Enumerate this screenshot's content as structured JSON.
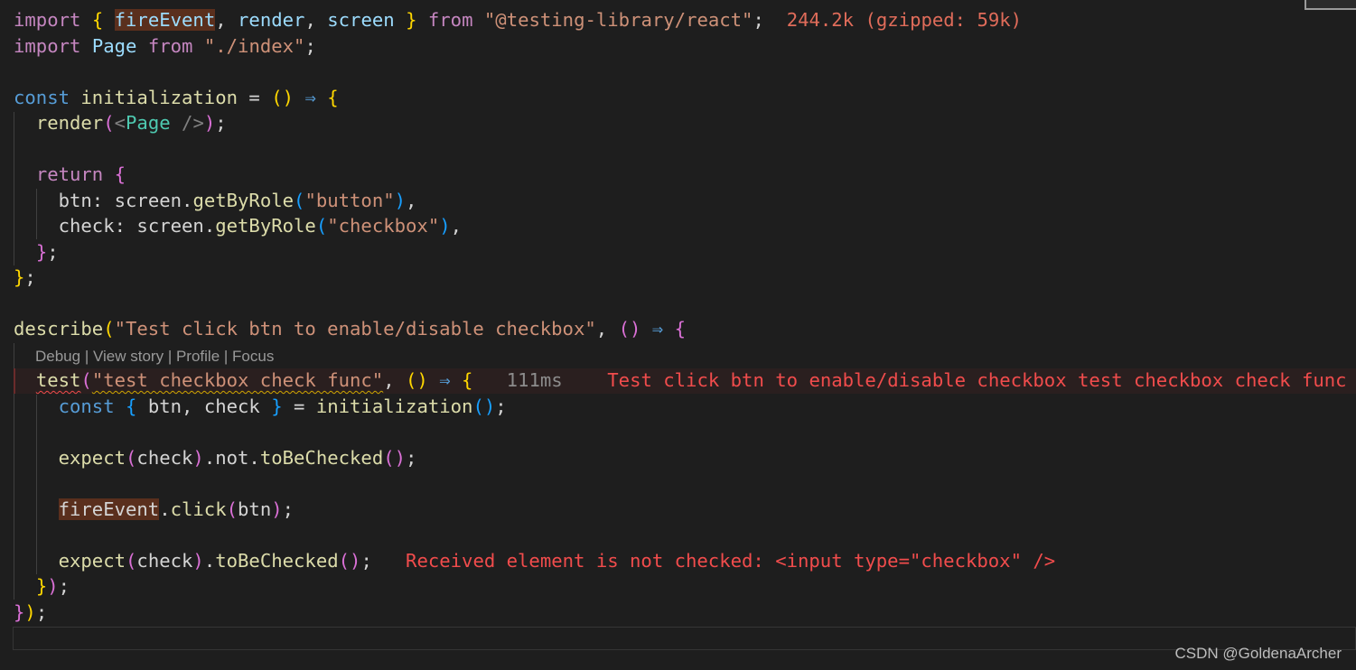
{
  "editor": {
    "lines": {
      "l1": {
        "import_kw": "import",
        "brace_open": "{",
        "fireEvent": "fireEvent",
        "comma1": ",",
        "render": "render",
        "comma2": ",",
        "screen": "screen",
        "brace_close": "}",
        "from_kw": "from",
        "module": "\"@testing-library/react\"",
        "semi": ";",
        "size_hint": "244.2k (gzipped: 59k)"
      },
      "l2": {
        "import_kw": "import",
        "page": "Page",
        "from_kw": "from",
        "module": "\"./index\"",
        "semi": ";"
      },
      "l4": {
        "const_kw": "const",
        "name": "initialization",
        "eq": "=",
        "parens": "()",
        "arrow": "⇒",
        "brace": "{"
      },
      "l5": {
        "render": "render",
        "paren_open": "(",
        "tag_open": "<",
        "tag_name": "Page",
        "tag_close": "/>",
        "paren_close": ")",
        "semi": ";"
      },
      "l7": {
        "return_kw": "return",
        "brace": "{"
      },
      "l8": {
        "prop": "btn:",
        "obj": "screen",
        "dot": ".",
        "method": "getByRole",
        "paren_open": "(",
        "arg": "\"button\"",
        "paren_close": ")",
        "comma": ","
      },
      "l9": {
        "prop": "check:",
        "obj": "screen",
        "dot": ".",
        "method": "getByRole",
        "paren_open": "(",
        "arg": "\"checkbox\"",
        "paren_close": ")",
        "comma": ","
      },
      "l10": {
        "brace": "}",
        "semi": ";"
      },
      "l11": {
        "brace": "}",
        "semi": ";"
      },
      "l13": {
        "fn": "describe",
        "paren_open": "(",
        "arg": "\"Test click btn to enable/disable checkbox\"",
        "comma": ",",
        "parens": "()",
        "arrow": "⇒",
        "brace": "{"
      },
      "l14": {
        "fn": "test",
        "paren_open": "(",
        "arg": "\"test checkbox check func\"",
        "comma": ",",
        "parens": "()",
        "arrow": "⇒",
        "brace": "{",
        "duration": "111ms",
        "error": "Test click btn to enable/disable checkbox test checkbox check func"
      },
      "l15": {
        "const_kw": "const",
        "brace_open": "{",
        "names": "btn, check",
        "brace_close": "}",
        "eq": "=",
        "fn": "initialization",
        "parens": "()",
        "semi": ";"
      },
      "l17": {
        "fn": "expect",
        "paren_open": "(",
        "arg": "check",
        "paren_close": ")",
        "chain": ".not.",
        "method": "toBeChecked",
        "parens": "()",
        "semi": ";"
      },
      "l19": {
        "obj": "fireEvent",
        "dot": ".",
        "method": "click",
        "paren_open": "(",
        "arg": "btn",
        "paren_close": ")",
        "semi": ";"
      },
      "l21": {
        "fn": "expect",
        "paren_open": "(",
        "arg": "check",
        "paren_close": ")",
        "dot": ".",
        "method": "toBeChecked",
        "parens": "()",
        "semi": ";",
        "error": "Received element is not checked: <input type=\"checkbox\" />"
      },
      "l22": {
        "brace": "}",
        "paren": ")",
        "semi": ";"
      },
      "l23": {
        "brace": "}",
        "paren": ")",
        "semi": ";"
      }
    },
    "codelens": {
      "debug": "Debug",
      "sep1": " | ",
      "view_story": "View story",
      "sep2": " | ",
      "profile": "Profile",
      "sep3": " | ",
      "focus": "Focus"
    }
  },
  "watermark": "CSDN @GoldenaArcher",
  "colors": {
    "background": "#1e1e1e",
    "keyword": "#c586c0",
    "declaration": "#569cd6",
    "function": "#dcdcaa",
    "variable": "#9cdcfe",
    "string": "#ce9178",
    "error": "#f14c4c"
  }
}
